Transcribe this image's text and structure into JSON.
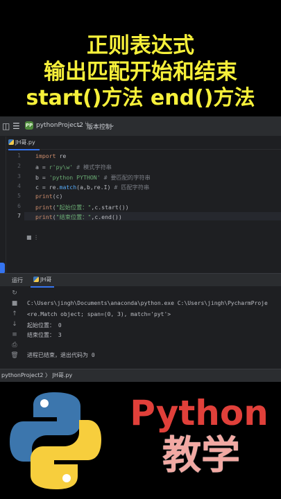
{
  "titles": {
    "line1": "正则表达式",
    "line2": "输出匹配开始和结束",
    "line3": "start()方法 end()方法"
  },
  "ide": {
    "project_badge": "PP",
    "project_name": "pythonProject2",
    "vcs": "版本控制",
    "tab_label": "JH哥.py",
    "line_numbers": [
      "1",
      "2",
      "3",
      "4",
      "5",
      "6",
      "7"
    ],
    "code": {
      "l1_kw": "import",
      "l1_rest": " re",
      "l2_a": "a = ",
      "l2_str": "r'py\\w'",
      "l2_cm": " # 模式字符串",
      "l3_a": "b = ",
      "l3_str": "'python PYTHON'",
      "l3_cm": " # 要匹配的字符串",
      "l4_a": "c = re.",
      "l4_fn": "match",
      "l4_b": "(a,b,re.I)",
      "l4_cm": " # 匹配字符串",
      "l5_fn": "print",
      "l5_b": "(c)",
      "l6_fn": "print",
      "l6_b1": "(",
      "l6_str": "\"起始位置：\"",
      "l6_b2": ",c.start())",
      "l7_fn": "print",
      "l7_b1": "(",
      "l7_str": "\"结束位置：\"",
      "l7_b2": ",c.end())"
    },
    "run_label": "运行",
    "run_tab": "JH哥",
    "console": {
      "cmd": "C:\\Users\\jingh\\Documents\\anaconda\\python.exe C:\\Users\\jingh\\PycharmProje",
      "match": "<re.Match object; span=(0, 3), match='pyt'>",
      "start": "起始位置： 0",
      "end": "结束位置： 3",
      "exit": "进程已结束，退出代码为 0"
    },
    "status_path": "pythonProject2 〉 JH哥.py"
  },
  "branding": {
    "python_word": "Python",
    "teaching": "教学"
  },
  "colors": {
    "title_yellow": "#f6f03a",
    "python_red": "#e0403a",
    "accent_blue": "#3574f0"
  }
}
